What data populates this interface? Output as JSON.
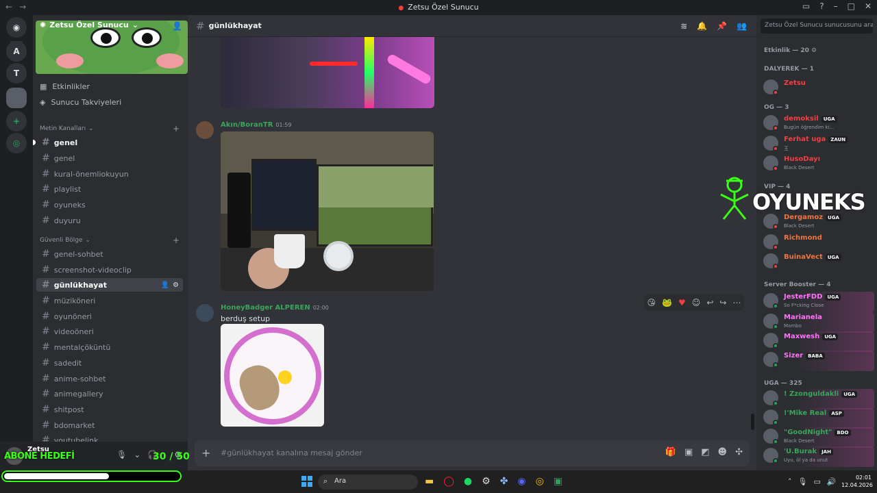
{
  "window": {
    "title": "Zetsu Özel Sunucu"
  },
  "guilds": {
    "letters": [
      "A",
      "T"
    ]
  },
  "server": {
    "name": "Zetsu Özel Sunucu",
    "menu": [
      "Etkinlikler",
      "Sunucu Takviyeleri"
    ]
  },
  "categories": [
    {
      "name": "Metin Kanalları",
      "channels": [
        "genel",
        "genel",
        "kural-önemliokuyun",
        "playlist",
        "oyuneks",
        "duyuru"
      ]
    },
    {
      "name": "Güvenli Bölge",
      "channels": [
        "genel-sohbet",
        "screenshot-videoclip",
        "günlükhayat",
        "müzikönerі",
        "oyunöneri",
        "videoöneri",
        "mentalçöküntü",
        "sadedit",
        "anime-sohbet",
        "animegallery",
        "shitpost",
        "bdomarket",
        "youtubelink"
      ]
    }
  ],
  "active_channel": "günlükhayat",
  "user": {
    "name": "Zetsu"
  },
  "overlay": {
    "abone_label": "ABONE HEDEFİ",
    "abone_count": "30 / 50",
    "progress": 0.6,
    "logo_text": "OYUNEKS"
  },
  "messages": [
    {
      "author": "Akın/BoranTR",
      "time": "01:59",
      "text": ""
    },
    {
      "author": "HoneyBadger ALPEREN",
      "time": "02:00",
      "text": "berduş setup"
    }
  ],
  "composer": {
    "placeholder": "#günlükhayat kanalına mesaj gönder"
  },
  "search": {
    "placeholder": "Zetsu Özel Sunucu sunucusunu ara"
  },
  "members": {
    "header": "Etkinlik — 20",
    "groups": [
      {
        "name": "DALYEREK — 1",
        "members": [
          {
            "name": "Zetsu",
            "color": "#f23f42",
            "sub": "",
            "tag": ""
          }
        ]
      },
      {
        "name": "OG — 3",
        "members": [
          {
            "name": "demoksil",
            "color": "#f23f42",
            "sub": "Bugün öğrendim ki...",
            "tag": "UGA"
          },
          {
            "name": "Ferhat uga",
            "color": "#f23f42",
            "sub": "王",
            "tag": "ZAUN"
          },
          {
            "name": "HusoDayı",
            "color": "#f23f42",
            "sub": "Black Desert",
            "tag": ""
          }
        ]
      },
      {
        "name": "VIP — 4",
        "members": [
          {
            "name": "Dergamoz",
            "color": "#f0743e",
            "sub": "Black Desert",
            "tag": "UGA"
          },
          {
            "name": "Richmond",
            "color": "#f0743e",
            "sub": "",
            "tag": ""
          },
          {
            "name": "BuinaVect",
            "color": "#f0743e",
            "sub": "",
            "tag": "UGA"
          }
        ]
      },
      {
        "name": "Server Booster — 4",
        "members": [
          {
            "name": "JesterFDD",
            "color": "#ff73fa",
            "sub": "So F*cking Close",
            "tag": "UGA"
          },
          {
            "name": "Marianela",
            "color": "#ff73fa",
            "sub": "Mambo",
            "tag": ""
          },
          {
            "name": "Maxwesh",
            "color": "#ff73fa",
            "sub": "",
            "tag": "UGA"
          },
          {
            "name": "Sizer",
            "color": "#ff73fa",
            "sub": "",
            "tag": "BABA"
          }
        ]
      },
      {
        "name": "UGA — 325",
        "members": [
          {
            "name": "! Zzonguldakli",
            "color": "#3ba55c",
            "sub": "",
            "tag": "UGA"
          },
          {
            "name": "!'Mike Real",
            "color": "#3ba55c",
            "sub": "",
            "tag": "ASP"
          },
          {
            "name": "\"GoodNight\"",
            "color": "#3ba55c",
            "sub": "Black Desert",
            "tag": "BDO"
          },
          {
            "name": "'U.Burak",
            "color": "#3ba55c",
            "sub": "Uyu, öl ya da unut",
            "tag": "JAH"
          }
        ]
      }
    ]
  },
  "taskbar": {
    "search": "Ara",
    "time": "02:01",
    "date": "12.04.2026"
  }
}
